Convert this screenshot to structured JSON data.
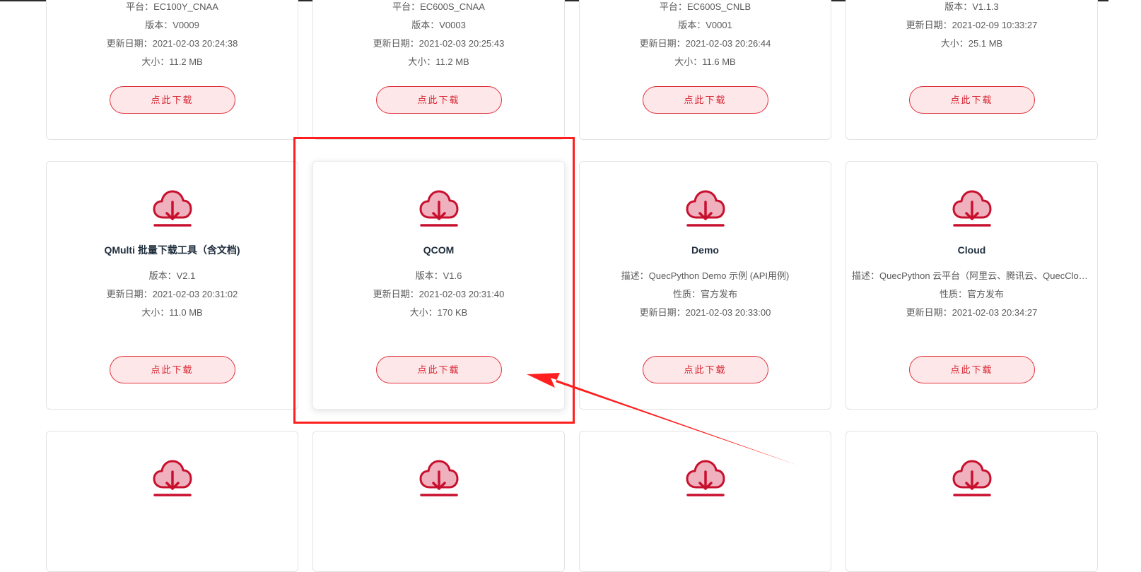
{
  "colors": {
    "accent": "#d92632",
    "button_bg": "#fde7e9",
    "highlight": "#ff1f1f",
    "cloud_fill": "#efb1bd",
    "cloud_stroke": "#c8102e"
  },
  "icons": {
    "cloud": "cloud-download-icon"
  },
  "download_label": "点此下载",
  "row1": [
    {
      "lines": [
        "平台：EC100Y_CNAA",
        "版本：V0009",
        "更新日期：2021-02-03 20:24:38",
        "大小：11.2 MB"
      ]
    },
    {
      "lines": [
        "平台：EC600S_CNAA",
        "版本：V0003",
        "更新日期：2021-02-03 20:25:43",
        "大小：11.2 MB"
      ]
    },
    {
      "lines": [
        "平台：EC600S_CNLB",
        "版本：V0001",
        "更新日期：2021-02-03 20:26:44",
        "大小：11.6 MB"
      ]
    },
    {
      "lines": [
        "版本：V1.1.3",
        "更新日期：2021-02-09 10:33:27",
        "大小：25.1 MB"
      ]
    }
  ],
  "row2": [
    {
      "title": "QMulti 批量下载工具（含文档)",
      "lines": [
        "版本：V2.1",
        "更新日期：2021-02-03 20:31:02",
        "大小：11.0 MB"
      ]
    },
    {
      "title": "QCOM",
      "lines": [
        "版本：V1.6",
        "更新日期：2021-02-03 20:31:40",
        "大小：170 KB"
      ]
    },
    {
      "title": "Demo",
      "lines": [
        "描述：QuecPython Demo 示例 (API用例)",
        "性质：官方发布",
        "更新日期：2021-02-03 20:33:00"
      ]
    },
    {
      "title": "Cloud",
      "lines": [
        "描述：QuecPython 云平台（阿里云、腾讯云、QuecCloud、华为云）",
        "性质：官方发布",
        "更新日期：2021-02-03 20:34:27"
      ]
    }
  ]
}
